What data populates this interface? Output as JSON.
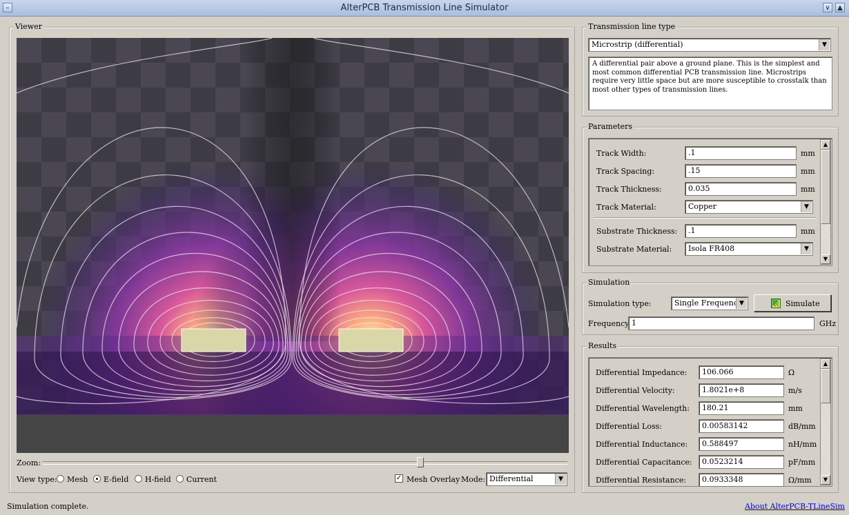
{
  "window": {
    "title": "AlterPCB Transmission Line Simulator",
    "btn_min": "∨",
    "btn_close": "▲",
    "btn_menu": "–"
  },
  "viewer": {
    "label": "Viewer",
    "zoom_label": "Zoom:",
    "zoom_level": 0.72,
    "view_type_label": "View type:",
    "view_options": [
      {
        "label": "Mesh",
        "selected": false
      },
      {
        "label": "E-field",
        "selected": true
      },
      {
        "label": "H-field",
        "selected": false
      },
      {
        "label": "Current",
        "selected": false
      }
    ],
    "mesh_overlay_label": "Mesh Overlay",
    "mesh_overlay_checked": true,
    "mode_label": "Mode:",
    "mode_value": "Differential"
  },
  "tline": {
    "label": "Transmission line type",
    "type_value": "Microstrip (differential)",
    "description": "A differential pair above a ground plane. This is the simplest and most common differential PCB transmission line. Microstrips require very little space but are more susceptible to crosstalk than most other types of transmission lines."
  },
  "parameters": {
    "label": "Parameters",
    "rows": [
      {
        "label": "Track Width:",
        "value": ".1",
        "unit": "mm"
      },
      {
        "label": "Track Spacing:",
        "value": ".15",
        "unit": "mm"
      },
      {
        "label": "Track Thickness:",
        "value": "0.035",
        "unit": "mm"
      },
      {
        "label": "Track Material:",
        "value": "Copper",
        "unit": ""
      },
      {
        "label": "Substrate Thickness:",
        "value": ".1",
        "unit": "mm"
      },
      {
        "label": "Substrate Material:",
        "value": "Isola FR408",
        "unit": ""
      }
    ]
  },
  "simulation": {
    "label": "Simulation",
    "type_label": "Simulation type:",
    "type_value": "Single Frequency",
    "simulate_label": "Simulate",
    "frequency_label": "Frequency:",
    "frequency_value": "1",
    "frequency_unit": "GHz"
  },
  "results": {
    "label": "Results",
    "rows": [
      {
        "label": "Differential Impedance:",
        "value": "106.066",
        "unit": "Ω"
      },
      {
        "label": "Differential Velocity:",
        "value": "1.8021e+8",
        "unit": "m/s"
      },
      {
        "label": "Differential Wavelength:",
        "value": "180.21",
        "unit": "mm"
      },
      {
        "label": "Differential Loss:",
        "value": "0.00583142",
        "unit": "dB/mm"
      },
      {
        "label": "Differential Inductance:",
        "value": "0.588497",
        "unit": "nH/mm"
      },
      {
        "label": "Differential Capacitance:",
        "value": "0.0523214",
        "unit": "pF/mm"
      },
      {
        "label": "Differential Resistance:",
        "value": "0.0933348",
        "unit": "Ω/mm"
      }
    ]
  },
  "status": {
    "text": "Simulation complete.",
    "about_link": "About AlterPCB-TLineSim"
  }
}
